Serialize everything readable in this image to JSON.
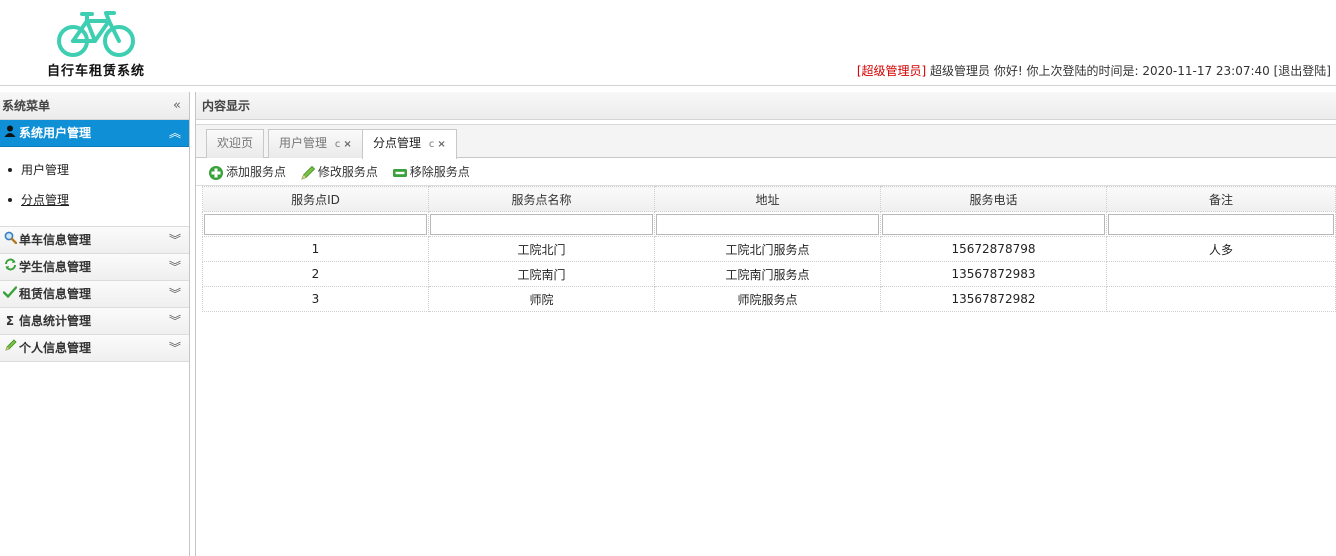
{
  "header": {
    "logo_text": "自行车租赁系统",
    "role": "[超级管理员]",
    "user_greeting": "超级管理员 你好! 你上次登陆的时间是:",
    "last_login": "2020-11-17 23:07:40",
    "logout_label": "[退出登陆]"
  },
  "sidebar": {
    "title": "系统菜单",
    "collapse_icon": "«",
    "sections": [
      {
        "label": "系统用户管理",
        "icon": "user-icon"
      },
      {
        "label": "单车信息管理",
        "icon": "search-icon"
      },
      {
        "label": "学生信息管理",
        "icon": "refresh-icon"
      },
      {
        "label": "租赁信息管理",
        "icon": "check-icon"
      },
      {
        "label": "信息统计管理",
        "icon": "sigma-icon"
      },
      {
        "label": "个人信息管理",
        "icon": "pencil-icon"
      }
    ],
    "sub_items": [
      "用户管理",
      "分点管理"
    ]
  },
  "main": {
    "title": "内容显示",
    "tabs": [
      {
        "label": "欢迎页",
        "closable": false
      },
      {
        "label": "用户管理",
        "closable": true
      },
      {
        "label": "分点管理",
        "closable": true,
        "active": true
      }
    ],
    "tab_tools": "c",
    "tab_close": "×",
    "toolbar": {
      "add_label": "添加服务点",
      "edit_label": "修改服务点",
      "remove_label": "移除服务点"
    },
    "table": {
      "columns": [
        "服务点ID",
        "服务点名称",
        "地址",
        "服务电话",
        "备注"
      ],
      "rows": [
        [
          "1",
          "工院北门",
          "工院北门服务点",
          "15672878798",
          "人多"
        ],
        [
          "2",
          "工院南门",
          "工院南门服务点",
          "13567872983",
          ""
        ],
        [
          "3",
          "师院",
          "师院服务点",
          "13567872982",
          ""
        ]
      ]
    }
  },
  "colors": {
    "accent": "#0e8fd6",
    "logo": "#3ecfb2",
    "role_red": "#d40000"
  }
}
